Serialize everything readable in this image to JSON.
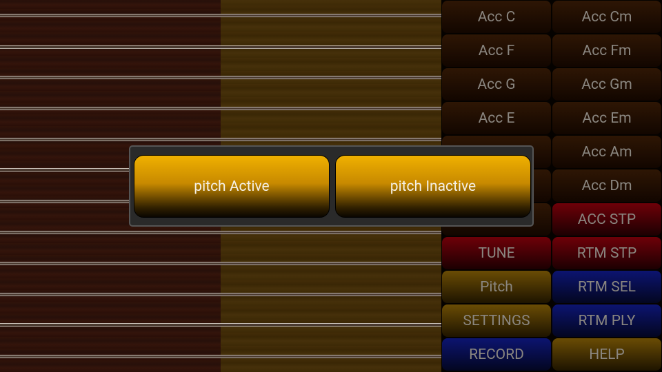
{
  "buttons": {
    "col1": [
      "Acc C",
      "Acc F",
      "Acc G",
      "Acc E",
      "",
      "",
      "",
      "TUNE",
      "Pitch",
      "SETTINGS",
      "RECORD"
    ],
    "col2": [
      "Acc Cm",
      "Acc Fm",
      "Acc Gm",
      "Acc Em",
      "Acc Am",
      "Acc Dm",
      "ACC STP",
      "RTM STP",
      "RTM SEL",
      "RTM PLY",
      "HELP"
    ]
  },
  "dialog": {
    "option1": "pitch Active",
    "option2": "pitch Inactive"
  },
  "colors": {
    "accent": "#f0b000",
    "red": "#6e0008",
    "blue": "#0c1470",
    "gold": "#6a4c04"
  }
}
